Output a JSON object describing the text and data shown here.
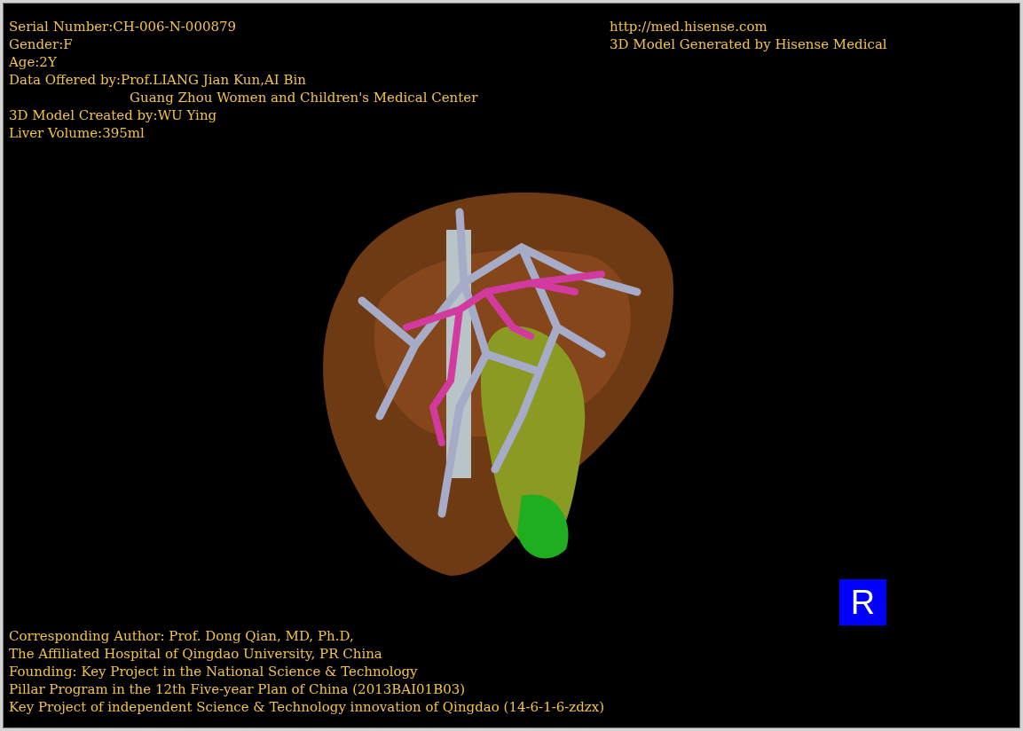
{
  "info_top_left": [
    {
      "text": "Serial Number:CH-006-N-000879",
      "kind": "line"
    },
    {
      "text": "Gender:F",
      "kind": "line"
    },
    {
      "text": "Age:2Y",
      "kind": "line"
    },
    {
      "text": "Data Offered by:Prof.LIANG Jian Kun,AI Bin",
      "kind": "line"
    },
    {
      "text": "Guang Zhou Women and Children's Medical Center",
      "kind": "continuation"
    },
    {
      "text": "3D Model Created by:WU Ying",
      "kind": "line"
    },
    {
      "text": "Liver Volume:395ml",
      "kind": "line"
    }
  ],
  "info_top_right": [
    "http://med.hisense.com",
    "3D Model Generated by Hisense Medical"
  ],
  "orientation_marker": "R",
  "info_bottom_left": [
    "Corresponding Author: Prof. Dong Qian, MD, Ph.D,",
    "The Affiliated Hospital of Qingdao University, PR China",
    "Founding: Key Project in the National Science & Technology",
    "Pillar Program in the 12th Five-year Plan of China (2013BAI01B03)",
    "Key Project of independent Science & Technology innovation of Qingdao (14-6-1-6-zdzx)"
  ]
}
